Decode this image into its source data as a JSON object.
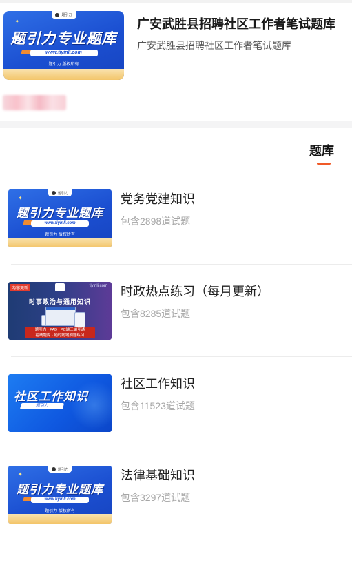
{
  "header": {
    "title": "广安武胜县招聘社区工作者笔试题库",
    "subtitle": "广安武胜县招聘社区工作者笔试题库",
    "cover": {
      "headline": "题引力专业题库",
      "url": "www.tiyinli.com",
      "credit": "题引力 版权所有",
      "badge": "题引力"
    }
  },
  "tab": {
    "label": "题库"
  },
  "cover_common": {
    "headline": "题引力专业题库",
    "url": "www.tiyinli.com",
    "credit": "题引力 版权所有",
    "badge": "题引力"
  },
  "politics_cover": {
    "tag": "内容更新",
    "site": "tiyinli.com",
    "subject": "时事政治与通用知识",
    "foot_line1": "题引力 · PAD · PC端三端互通",
    "foot_line2": "在线题库 · 随时随地刷题练习"
  },
  "community_cover": {
    "headline": "社区工作知识",
    "pill": "题引力"
  },
  "items": [
    {
      "name": "党务党建知识",
      "count": "包含2898道试题",
      "cover": "brand"
    },
    {
      "name": "时政热点练习（每月更新）",
      "count": "包含8285道试题",
      "cover": "politics"
    },
    {
      "name": "社区工作知识",
      "count": "包含11523道试题",
      "cover": "community"
    },
    {
      "name": "法律基础知识",
      "count": "包含3297道试题",
      "cover": "brand"
    }
  ],
  "colors": {
    "accent": "#f05a28",
    "cover_blue": "#1b4fd1",
    "count_text": "#a6a6a6"
  }
}
